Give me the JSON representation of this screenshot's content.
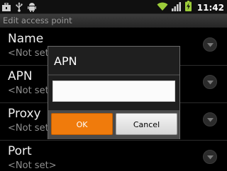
{
  "status_bar": {
    "time": "11:42",
    "left_icons": [
      "briefcase-icon",
      "usb-icon",
      "android-icon"
    ],
    "right_icons": [
      "wifi-icon",
      "signal-icon",
      "battery-charging-icon"
    ],
    "accent": "#9ccc3a"
  },
  "title_bar": {
    "title": "Edit access point"
  },
  "list": {
    "items": [
      {
        "title": "Name",
        "summary": "<Not set>"
      },
      {
        "title": "APN",
        "summary": "<Not set>"
      },
      {
        "title": "Proxy",
        "summary": "<Not set>"
      },
      {
        "title": "Port",
        "summary": "<Not set>"
      }
    ]
  },
  "dialog": {
    "title": "APN",
    "input_value": "",
    "ok_label": "OK",
    "cancel_label": "Cancel",
    "ok_color": "#f07b0c"
  }
}
